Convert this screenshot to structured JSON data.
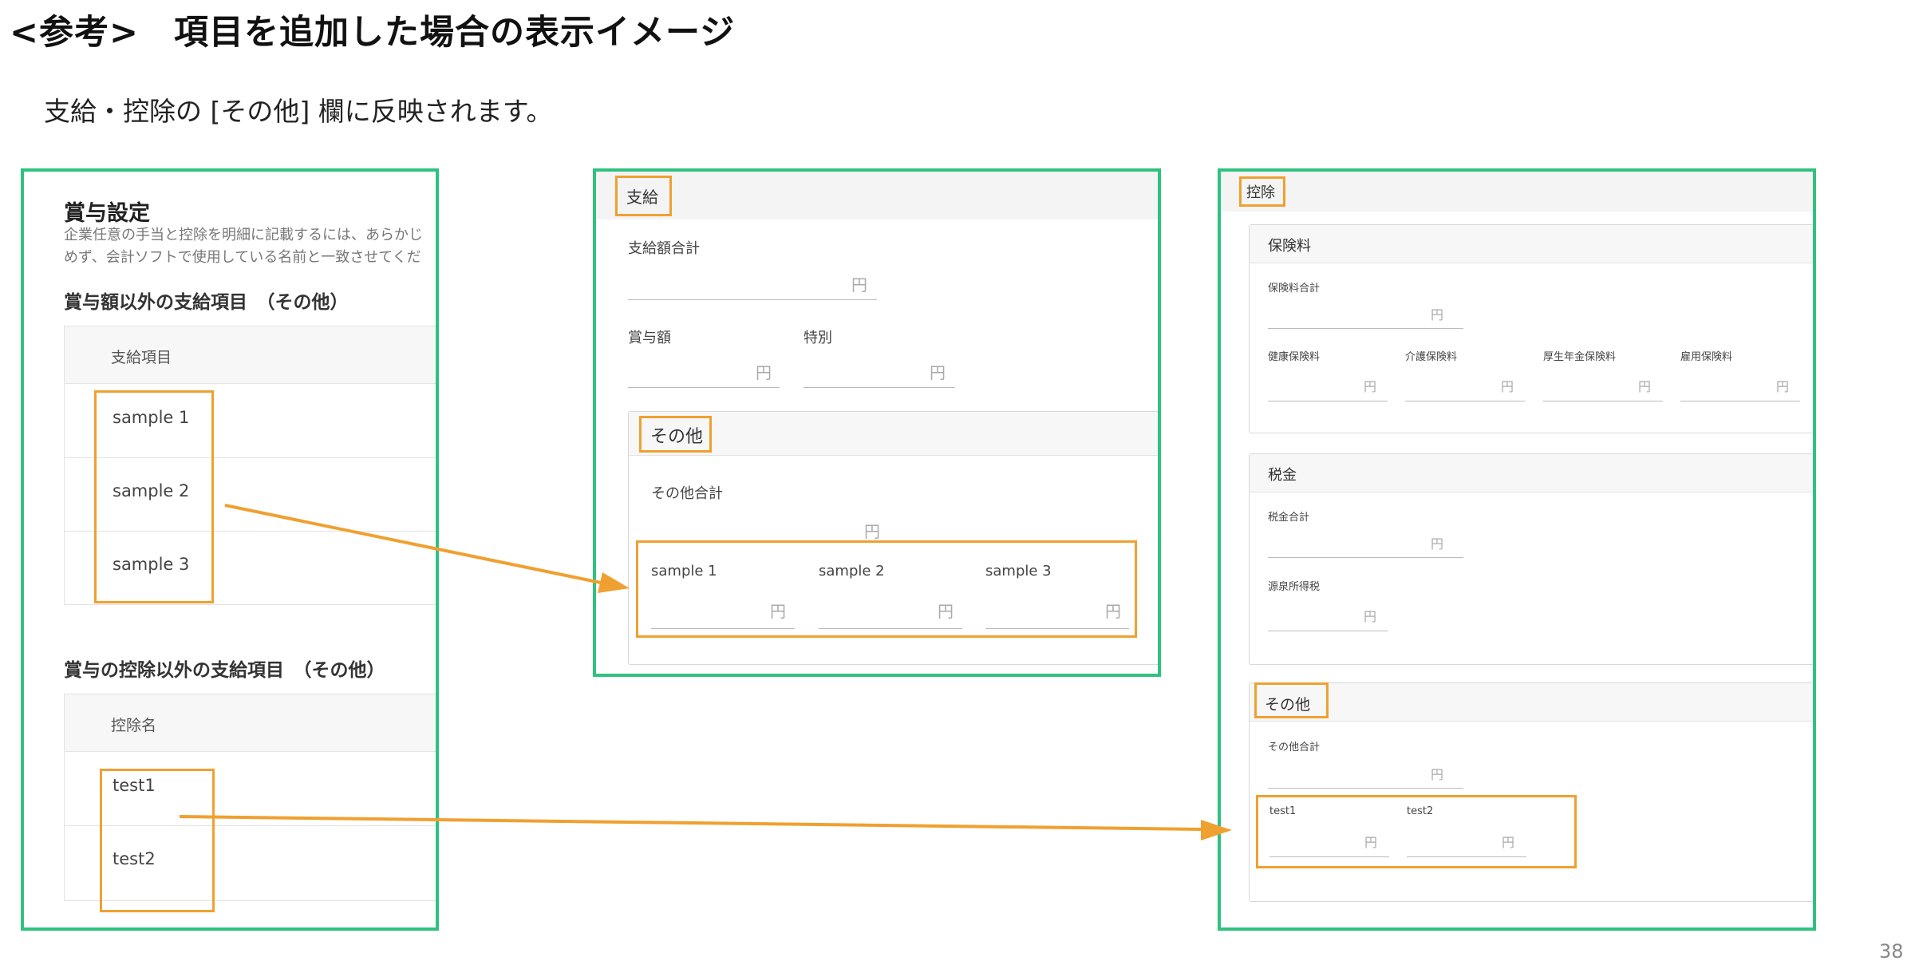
{
  "page": {
    "title": "<参考>　項目を追加した場合の表示イメージ",
    "subtitle": "支給・控除の [その他] 欄に反映されます。",
    "page_number": "38"
  },
  "settings_panel": {
    "title": "賞与設定",
    "description_line1": "企業任意の手当と控除を明細に記載するには、あらかじ",
    "description_line2": "めず、会計ソフトで使用している名前と一致させてくだ",
    "payment_section_title": "賞与額以外の支給項目　（その他）",
    "payment_column_header": "支給項目",
    "payment_items": [
      "sample 1",
      "sample 2",
      "sample 3"
    ],
    "deduction_section_title": "賞与の控除以外の支給項目　（その他）",
    "deduction_column_header": "控除名",
    "deduction_items": [
      "test1",
      "test2"
    ]
  },
  "payment_panel": {
    "header": "支給",
    "total_label": "支給額合計",
    "bonus_label": "賞与額",
    "special_label": "特別",
    "other_header": "その他",
    "other_total_label": "その他合計",
    "other_items": [
      "sample 1",
      "sample 2",
      "sample 3"
    ],
    "yen": "円"
  },
  "deduction_panel": {
    "header": "控除",
    "insurance": {
      "header": "保険料",
      "total_label": "保険料合計",
      "items": [
        "健康保険料",
        "介護保険料",
        "厚生年金保険料",
        "雇用保険料"
      ]
    },
    "tax": {
      "header": "税金",
      "total_label": "税金合計",
      "income_tax_label": "源泉所得税"
    },
    "other": {
      "header": "その他",
      "total_label": "その他合計",
      "items": [
        "test1",
        "test2"
      ]
    },
    "yen": "円"
  },
  "colors": {
    "panel_border": "#2fc27f",
    "highlight_box": "#f0a030",
    "arrow": "#f0a030"
  }
}
